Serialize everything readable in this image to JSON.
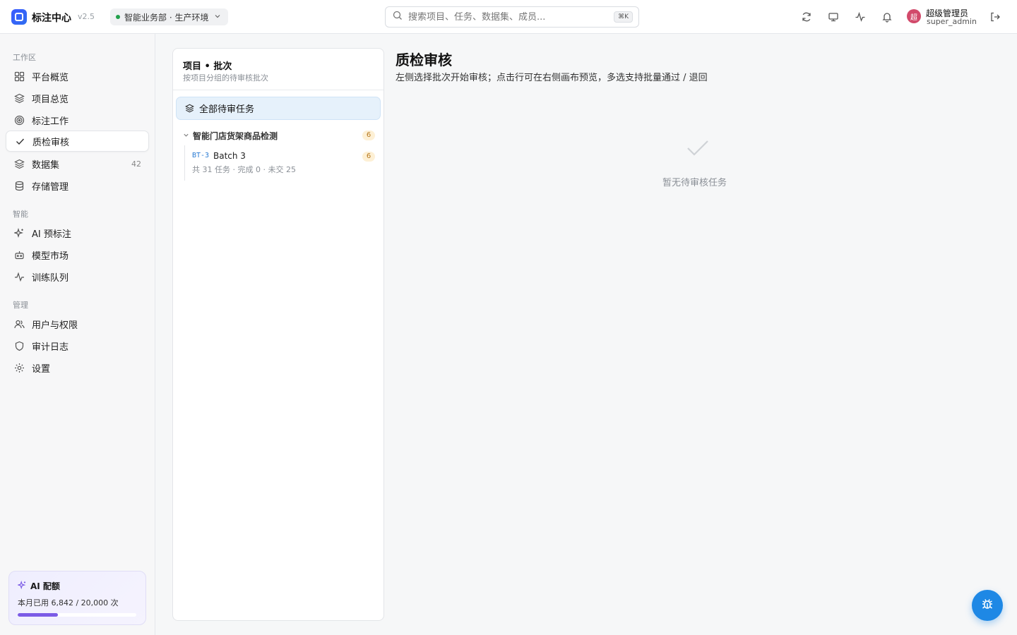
{
  "app": {
    "title": "标注中心",
    "version": "v2.5"
  },
  "env": {
    "label": "智能业务部 · 生产环境",
    "status_color": "#22a04b"
  },
  "search": {
    "placeholder": "搜索项目、任务、数据集、成员...",
    "shortcut": "⌘K"
  },
  "header_icons": [
    "refresh-icon",
    "monitor-icon",
    "activity-icon",
    "bell-icon",
    "logout-icon"
  ],
  "user": {
    "avatar_char": "超",
    "name": "超级管理员",
    "id": "super_admin"
  },
  "sidebar": {
    "sections": [
      {
        "label": "工作区",
        "items": [
          {
            "label": "平台概览",
            "icon": "grid-icon"
          },
          {
            "label": "项目总览",
            "icon": "layers-icon"
          },
          {
            "label": "标注工作",
            "icon": "target-icon"
          },
          {
            "label": "质检审核",
            "icon": "check-icon",
            "active": true
          },
          {
            "label": "数据集",
            "icon": "layers-icon",
            "count": "42"
          },
          {
            "label": "存储管理",
            "icon": "database-icon"
          }
        ]
      },
      {
        "label": "智能",
        "items": [
          {
            "label": "AI 预标注",
            "icon": "sparkles-icon"
          },
          {
            "label": "模型市场",
            "icon": "robot-icon"
          },
          {
            "label": "训练队列",
            "icon": "activity-icon"
          }
        ]
      },
      {
        "label": "管理",
        "items": [
          {
            "label": "用户与权限",
            "icon": "users-icon"
          },
          {
            "label": "审计日志",
            "icon": "shield-icon"
          },
          {
            "label": "设置",
            "icon": "gear-icon"
          }
        ]
      }
    ],
    "quota": {
      "title": "AI 配额",
      "text": "本月已用 6,842 / 20,000 次",
      "used": 6842,
      "total": 20000
    }
  },
  "batch_panel": {
    "title": "项目 • 批次",
    "subtitle": "按项目分组的待审核批次",
    "all_label": "全部待审任务",
    "project": {
      "name": "智能门店货架商品检测",
      "count": "6"
    },
    "batch": {
      "code": "BT-3",
      "name": "Batch 3",
      "meta": "共 31 任务 · 完成 0 · 未交 25",
      "count": "6"
    }
  },
  "main": {
    "title": "质检审核",
    "description": "左侧选择批次开始审核；点击行可在右侧画布预览，多选支持批量通过 / 退回",
    "empty_text": "暂无待审核任务"
  },
  "fab": {
    "icon": "bug-icon",
    "color": "#1e88e5"
  }
}
